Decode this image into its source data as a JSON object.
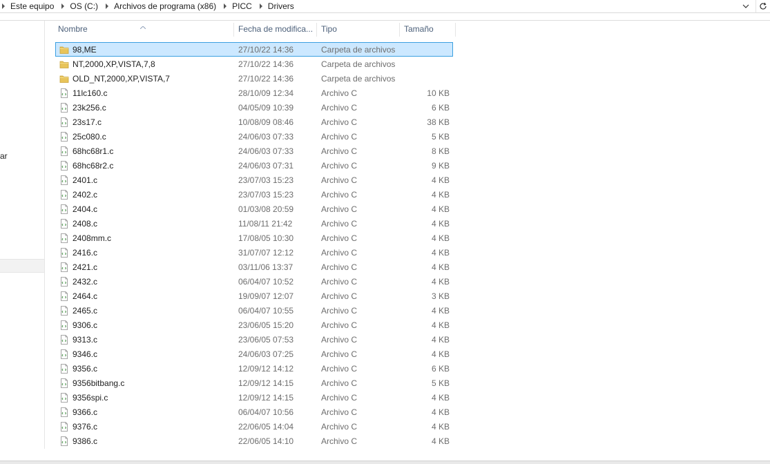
{
  "breadcrumb": [
    "Este equipo",
    "OS (C:)",
    "Archivos de programa (x86)",
    "PICC",
    "Drivers"
  ],
  "nav": {
    "partial_label": "ar"
  },
  "columns": {
    "name": "Nombre",
    "date": "Fecha de modifica...",
    "type": "Tipo",
    "size": "Tamaño"
  },
  "sort": {
    "column": "name",
    "direction": "ascending"
  },
  "files": [
    {
      "name": "98,ME",
      "date": "27/10/22 14:36",
      "type": "Carpeta de archivos",
      "size": "",
      "kind": "folder",
      "selected": true
    },
    {
      "name": "NT,2000,XP,VISTA,7,8",
      "date": "27/10/22 14:36",
      "type": "Carpeta de archivos",
      "size": "",
      "kind": "folder"
    },
    {
      "name": "OLD_NT,2000,XP,VISTA,7",
      "date": "27/10/22 14:36",
      "type": "Carpeta de archivos",
      "size": "",
      "kind": "folder"
    },
    {
      "name": "11lc160.c",
      "date": "28/10/09 12:34",
      "type": "Archivo C",
      "size": "10 KB",
      "kind": "file"
    },
    {
      "name": "23k256.c",
      "date": "04/05/09 10:39",
      "type": "Archivo C",
      "size": "6 KB",
      "kind": "file"
    },
    {
      "name": "23s17.c",
      "date": "10/08/09 08:46",
      "type": "Archivo C",
      "size": "38 KB",
      "kind": "file"
    },
    {
      "name": "25c080.c",
      "date": "24/06/03 07:33",
      "type": "Archivo C",
      "size": "5 KB",
      "kind": "file"
    },
    {
      "name": "68hc68r1.c",
      "date": "24/06/03 07:33",
      "type": "Archivo C",
      "size": "8 KB",
      "kind": "file"
    },
    {
      "name": "68hc68r2.c",
      "date": "24/06/03 07:31",
      "type": "Archivo C",
      "size": "9 KB",
      "kind": "file"
    },
    {
      "name": "2401.c",
      "date": "23/07/03 15:23",
      "type": "Archivo C",
      "size": "4 KB",
      "kind": "file"
    },
    {
      "name": "2402.c",
      "date": "23/07/03 15:23",
      "type": "Archivo C",
      "size": "4 KB",
      "kind": "file"
    },
    {
      "name": "2404.c",
      "date": "01/03/08 20:59",
      "type": "Archivo C",
      "size": "4 KB",
      "kind": "file"
    },
    {
      "name": "2408.c",
      "date": "11/08/11 21:42",
      "type": "Archivo C",
      "size": "4 KB",
      "kind": "file"
    },
    {
      "name": "2408mm.c",
      "date": "17/08/05 10:30",
      "type": "Archivo C",
      "size": "4 KB",
      "kind": "file"
    },
    {
      "name": "2416.c",
      "date": "31/07/07 12:12",
      "type": "Archivo C",
      "size": "4 KB",
      "kind": "file"
    },
    {
      "name": "2421.c",
      "date": "03/11/06 13:37",
      "type": "Archivo C",
      "size": "4 KB",
      "kind": "file"
    },
    {
      "name": "2432.c",
      "date": "06/04/07 10:52",
      "type": "Archivo C",
      "size": "4 KB",
      "kind": "file"
    },
    {
      "name": "2464.c",
      "date": "19/09/07 12:07",
      "type": "Archivo C",
      "size": "3 KB",
      "kind": "file"
    },
    {
      "name": "2465.c",
      "date": "06/04/07 10:55",
      "type": "Archivo C",
      "size": "4 KB",
      "kind": "file"
    },
    {
      "name": "9306.c",
      "date": "23/06/05 15:20",
      "type": "Archivo C",
      "size": "4 KB",
      "kind": "file"
    },
    {
      "name": "9313.c",
      "date": "23/06/05 07:53",
      "type": "Archivo C",
      "size": "4 KB",
      "kind": "file"
    },
    {
      "name": "9346.c",
      "date": "24/06/03 07:25",
      "type": "Archivo C",
      "size": "4 KB",
      "kind": "file"
    },
    {
      "name": "9356.c",
      "date": "12/09/12 14:12",
      "type": "Archivo C",
      "size": "6 KB",
      "kind": "file"
    },
    {
      "name": "9356bitbang.c",
      "date": "12/09/12 14:15",
      "type": "Archivo C",
      "size": "5 KB",
      "kind": "file"
    },
    {
      "name": "9356spi.c",
      "date": "12/09/12 14:15",
      "type": "Archivo C",
      "size": "4 KB",
      "kind": "file"
    },
    {
      "name": "9366.c",
      "date": "06/04/07 10:56",
      "type": "Archivo C",
      "size": "4 KB",
      "kind": "file"
    },
    {
      "name": "9376.c",
      "date": "22/06/05 14:04",
      "type": "Archivo C",
      "size": "4 KB",
      "kind": "file"
    },
    {
      "name": "9386.c",
      "date": "22/06/05 14:10",
      "type": "Archivo C",
      "size": "4 KB",
      "kind": "file"
    }
  ],
  "colors": {
    "selection_bg": "#cce8ff",
    "selection_border": "#3a9fe0",
    "header_text": "#4c607a",
    "folder": "#e8c45a"
  }
}
